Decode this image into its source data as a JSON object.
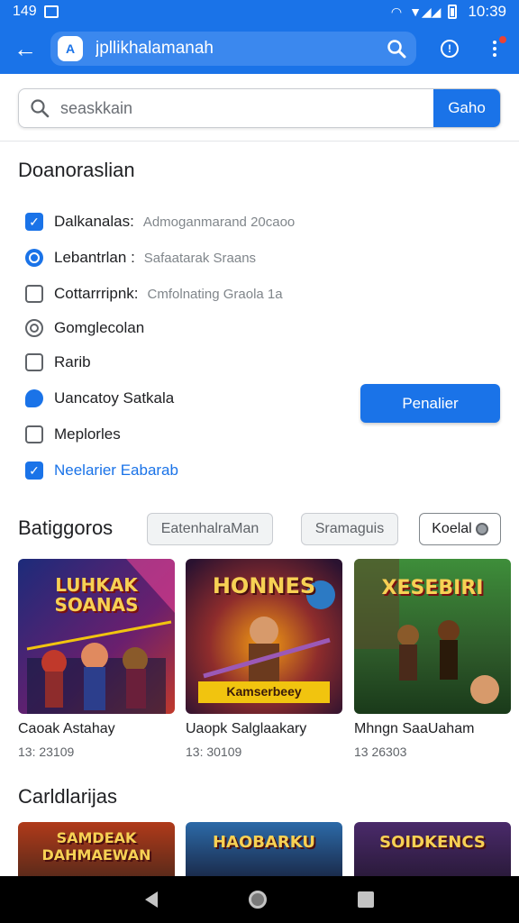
{
  "status": {
    "time_left": "149",
    "clock": "10:39",
    "signal": "▼◢◢"
  },
  "appbar": {
    "url": "jpllikhalamanah",
    "site_icon": "A"
  },
  "search": {
    "placeholder": "seaskkain",
    "go_label": "Gaho"
  },
  "options": {
    "title": "Doanoraslian",
    "items": [
      {
        "label": "Dalkanalas:",
        "sub": "Admoganmarand 20caoo",
        "icon": "checkbox-checked"
      },
      {
        "label": "Lebantrlan :",
        "sub": "Safaatarak Sraans",
        "icon": "radio-on"
      },
      {
        "label": "Cottarrripnk:",
        "sub": "Cmfolnating Graola 1a",
        "icon": "checkbox-unchecked"
      },
      {
        "label": "Gomglecolan",
        "sub": "",
        "icon": "radio-off"
      },
      {
        "label": "Rarib",
        "sub": "",
        "icon": "checkbox-unchecked"
      },
      {
        "label": "Uancatoy Satkala",
        "sub": "",
        "icon": "bubble"
      },
      {
        "label": "Meplorles",
        "sub": "",
        "icon": "checkbox-unchecked"
      },
      {
        "label": "Neelarier Eabarab",
        "sub": "",
        "icon": "checkbox-checked"
      }
    ],
    "button_label": "Penalier"
  },
  "games": {
    "title": "Batiggoros",
    "chips": [
      "EatenhalraMan",
      "Sramaguis",
      "Koelal"
    ],
    "cards": [
      {
        "title": "Caoak Astahay",
        "meta": "13: 23109",
        "art_text": "LUHKAK SOANAS",
        "colors": [
          "#2a3a8c",
          "#c0392b"
        ]
      },
      {
        "title": "Uaopk Salglaakary",
        "meta": "13: 30109",
        "art_text": "HONNES",
        "banner": "Kamserbeey",
        "colors": [
          "#4a1c2a",
          "#e67e22"
        ]
      },
      {
        "title": "Mhngn SaaUaham",
        "meta": "13 26303",
        "art_text": "XESEBIRI",
        "colors": [
          "#2e5a2a",
          "#8bc34a"
        ]
      }
    ]
  },
  "categories": {
    "title": "Carldlarijas",
    "thumbs": [
      "SAMDEAK DAHMAEWAN",
      "HAOBARKU",
      "SOIDKENCS"
    ]
  }
}
